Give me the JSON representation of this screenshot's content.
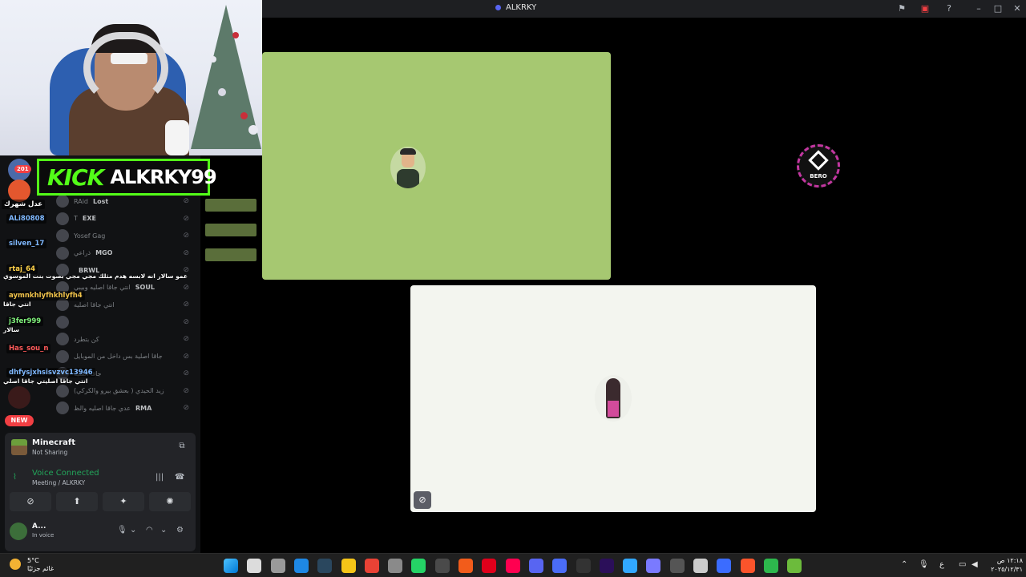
{
  "window": {
    "title": "ALKRKY"
  },
  "overlay": {
    "kick_label": "KICK",
    "kick_channel": "ALKRKY99",
    "unread_badge": "201",
    "new_badge": "NEW"
  },
  "chat": [
    {
      "user": "عدل شهرك",
      "color": "#ffffff",
      "message": ""
    },
    {
      "user": "ALi80808",
      "color": "#7fb8ff",
      "message": ""
    },
    {
      "user": "silven_17",
      "color": "#7fb8ff",
      "message": ""
    },
    {
      "user": "rtaj_64",
      "color": "#ffd24a",
      "message": "عمو سالار انه لابسه هدم مثلك مجي مجي بصوت بنت الموسوي"
    },
    {
      "user": "aymnkhlyfhkhlyfh4",
      "color": "#f0c24a",
      "message": "انتي جاقا"
    },
    {
      "user": "j3fer999",
      "color": "#7ff07a",
      "message": "سالار"
    },
    {
      "user": "Has_sou_n",
      "color": "#ff5a5a",
      "message": ""
    },
    {
      "user": "dhfysjxhsisvzvc13946",
      "color": "#7fb8ff",
      "message": "انتي جاقا اصليتي جاقا اصلي"
    }
  ],
  "members": [
    {
      "name": "RAid",
      "tag": "Lost"
    },
    {
      "name": "T",
      "tag": "EXE"
    },
    {
      "name": "Yosef Gag",
      "tag": ""
    },
    {
      "name": "ذراعي",
      "tag": "MGO"
    },
    {
      "name": "",
      "tag": "BRWL"
    },
    {
      "name": "انتي جاقا اصليه وبيبي",
      "tag": "SOUL"
    },
    {
      "name": "انتي جاقا اصليه",
      "tag": ""
    },
    {
      "name": "",
      "tag": ""
    },
    {
      "name": "كن بتطرد",
      "tag": ""
    },
    {
      "name": "جاقا اصلية بس داخل من الموبايل",
      "tag": ""
    },
    {
      "name": "جاقا اصليه",
      "tag": ""
    },
    {
      "name": "زيد الحيدي ( بعشق بيرو والكركي)",
      "tag": ""
    },
    {
      "name": "عدي جاقا اصليه والظ",
      "tag": "RMA"
    }
  ],
  "activity": {
    "game": "Minecraft",
    "status": "Not Sharing"
  },
  "voice": {
    "status": "Voice Connected",
    "channel": "Meeting / ALKRKY"
  },
  "user": {
    "name": "A...",
    "status": "In voice"
  },
  "tiles": {
    "bero_label": "BERO"
  },
  "taskbar": {
    "temperature": "5°C",
    "weather_desc": "غائم جزئيًا",
    "time": "١٢:١٨ ص",
    "date": "٢٠٢٥/١٢/٣١",
    "lang": "ع",
    "pinned": [
      "windows",
      "search",
      "task-view",
      "edge",
      "steam",
      "file-explorer",
      "chrome",
      "pc-manager",
      "whatsapp",
      "chatgpt",
      "brave-alt",
      "opera",
      "tiktok",
      "discord",
      "app-blue",
      "capcut",
      "premiere",
      "photoshop",
      "game-controller",
      "capcut-alt",
      "settings",
      "app-wave",
      "brave",
      "app-green",
      "minecraft"
    ]
  },
  "colors": {
    "kick_green": "#53fc18",
    "voice_green": "#23a55a",
    "discord_blurple": "#5865f2",
    "alert_red": "#f23f43"
  }
}
